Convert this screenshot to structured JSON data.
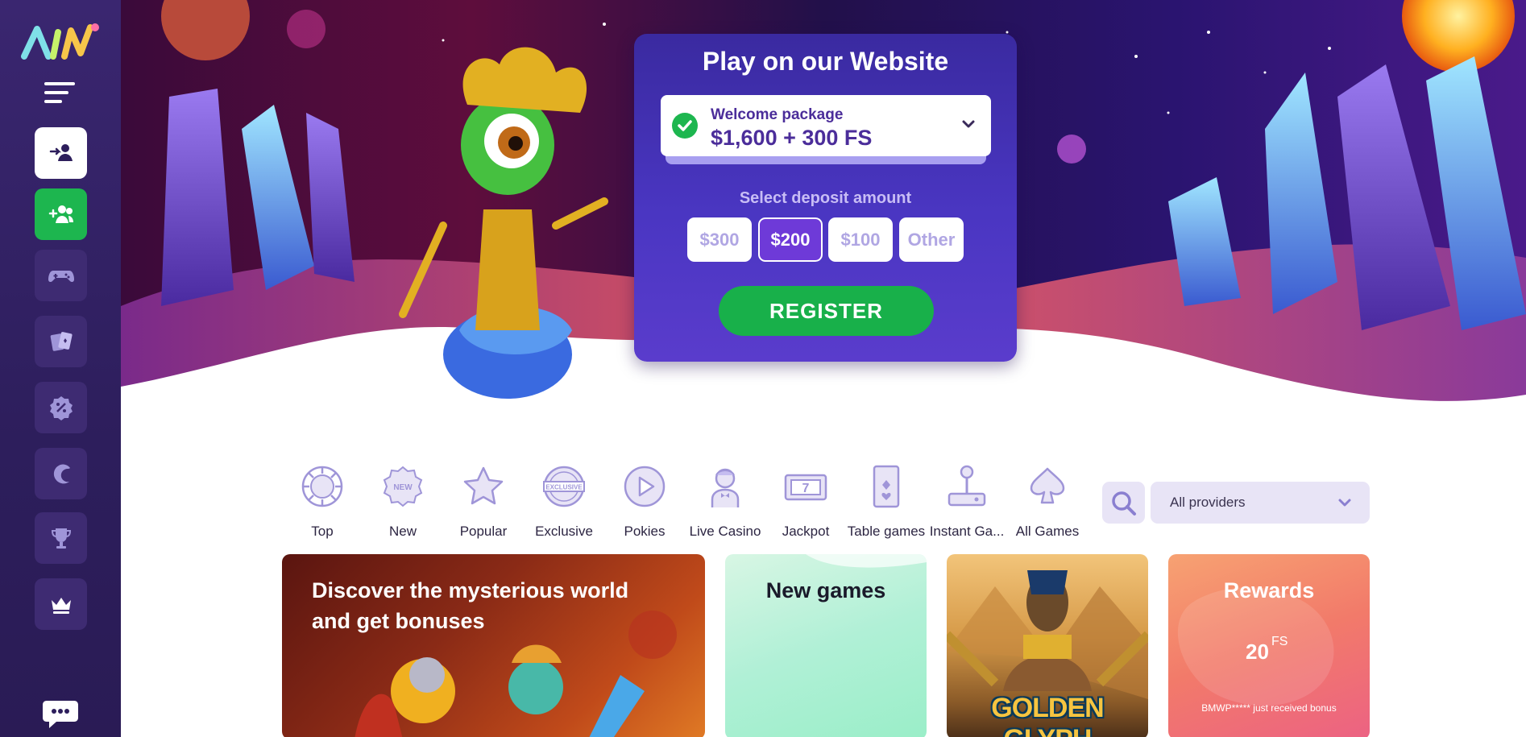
{
  "sidebar": {
    "logo": "logo",
    "menu_icon": "hamburger-menu-icon",
    "items": [
      {
        "icon": "login-user-icon",
        "style": "white"
      },
      {
        "icon": "register-users-icon",
        "style": "green"
      },
      {
        "icon": "gamepad-icon",
        "style": "dark"
      },
      {
        "icon": "cards-icon",
        "style": "dark"
      },
      {
        "icon": "percent-badge-icon",
        "style": "dark"
      },
      {
        "icon": "moon-icon",
        "style": "dark"
      },
      {
        "icon": "trophy-icon",
        "style": "dark"
      },
      {
        "icon": "crown-icon",
        "style": "dark"
      }
    ],
    "chat_icon": "chat-support-icon"
  },
  "promo": {
    "title": "Play on our Website",
    "package_label": "Welcome package",
    "package_value": "$1,600 + 300 FS",
    "deposit_label": "Select deposit amount",
    "amounts": [
      "$300",
      "$200",
      "$100",
      "Other"
    ],
    "selected_amount": "$200",
    "register_label": "REGISTER"
  },
  "categories": [
    {
      "label": "Top",
      "icon": "top-chip-icon"
    },
    {
      "label": "New",
      "icon": "new-badge-icon"
    },
    {
      "label": "Popular",
      "icon": "star-icon"
    },
    {
      "label": "Exclusive",
      "icon": "exclusive-badge-icon"
    },
    {
      "label": "Pokies",
      "icon": "play-icon"
    },
    {
      "label": "Live Casino",
      "icon": "dealer-icon"
    },
    {
      "label": "Jackpot",
      "icon": "slot-machine-icon"
    },
    {
      "label": "Table games",
      "icon": "playing-card-icon"
    },
    {
      "label": "Instant Ga...",
      "icon": "joystick-icon"
    },
    {
      "label": "All Games",
      "icon": "spade-icon"
    }
  ],
  "category_icon_text": {
    "new": "NEW",
    "exclusive": "EXCLUSIVE",
    "jackpot": "7"
  },
  "providers": {
    "selected": "All providers"
  },
  "tiles": {
    "discover_title": "Discover the mysterious world and get bonuses",
    "new_games_title": "New games",
    "golden_glyph_name": "GOLDEN GLYPH",
    "rewards_title": "Rewards",
    "rewards_fs_amount": "20",
    "rewards_fs_unit": "FS",
    "rewards_notice": "BMWP***** just received bonus"
  },
  "colors": {
    "sidebar": "#2d1e5c",
    "accent_green": "#1db64f",
    "accent_purple": "#6e3ad8",
    "icon_lavender": "#9f95d8"
  }
}
